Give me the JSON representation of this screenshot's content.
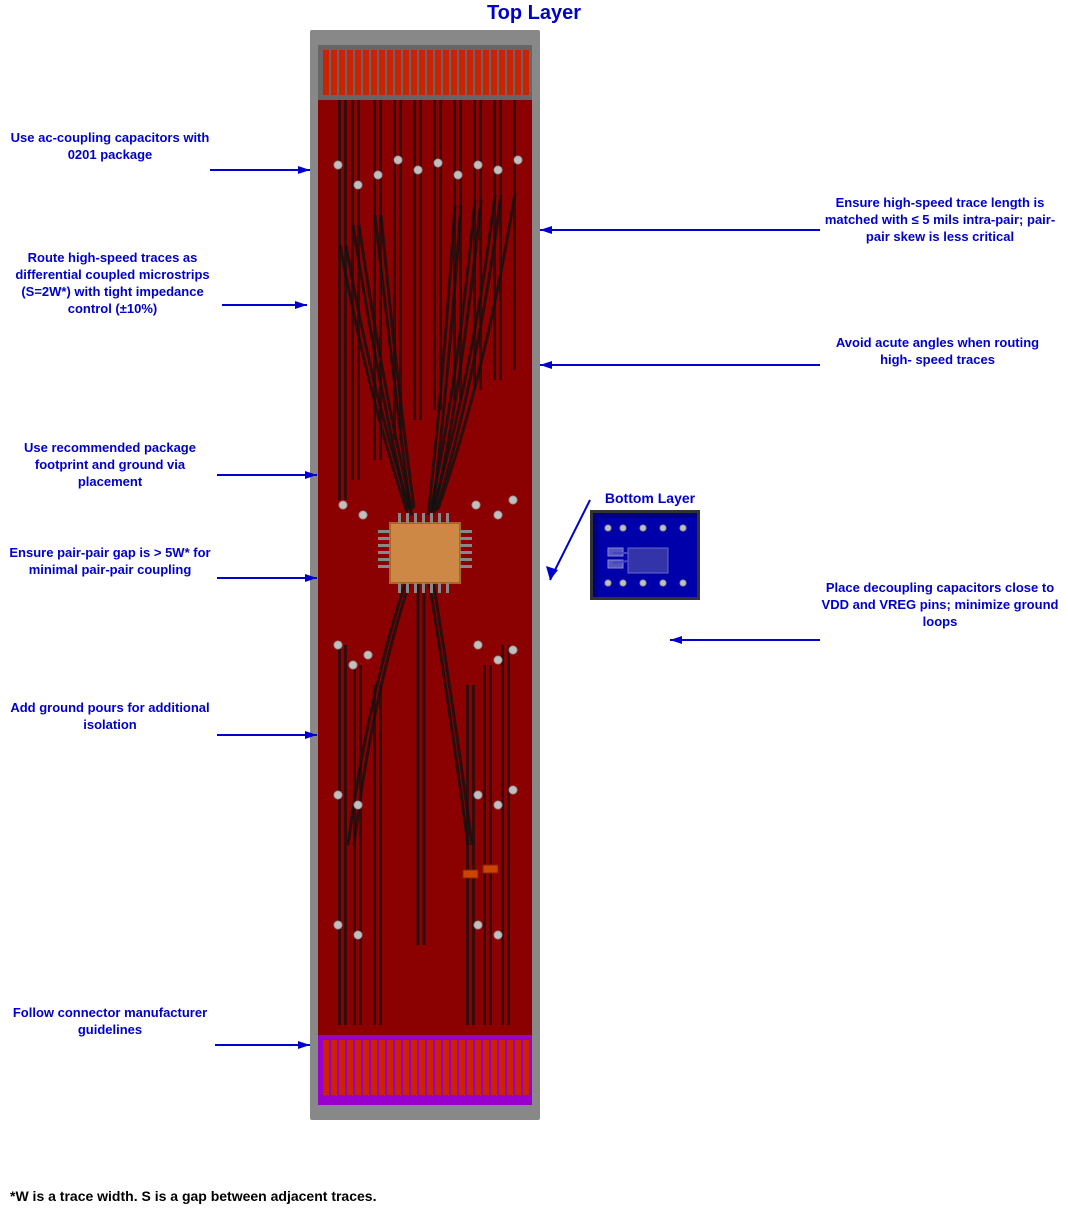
{
  "title": "Top Layer",
  "annotations": {
    "ac_coupling": "Use ac-coupling\ncapacitors with 0201\npackage",
    "high_speed_traces": "Route high-speed\ntraces as differential\ncoupled microstrips\n(S=2W*) with tight\nimpedance control\n(±10%)",
    "package_footprint": "Use recommended\npackage footprint and\nground via placement",
    "pair_gap": "Ensure pair-pair gap\nis > 5W* for minimal\npair-pair coupling",
    "ground_pours": "Add ground pours for\nadditional isolation",
    "follow_connector": "Follow connector\nmanufacturer\nguidelines",
    "trace_length": "Ensure high-speed\ntrace length is\nmatched with ≤ 5 mils\nintra-pair;  pair-pair\nskew is less critical",
    "avoid_acute": "Avoid acute angles\nwhen routing high-\nspeed traces",
    "decoupling": "Place decoupling\ncapacitors close to\nVDD and VREG pins;\nminimize ground\nloops",
    "bottom_layer": "Bottom Layer"
  },
  "footer": "*W is a trace width.  S is a\ngap between adjacent\ntraces.",
  "colors": {
    "annotation": "#0000cc",
    "pcb_red": "#8B0000",
    "pcb_gray": "#888888",
    "pcb_purple": "#9900cc",
    "arrow": "#0000cc"
  }
}
